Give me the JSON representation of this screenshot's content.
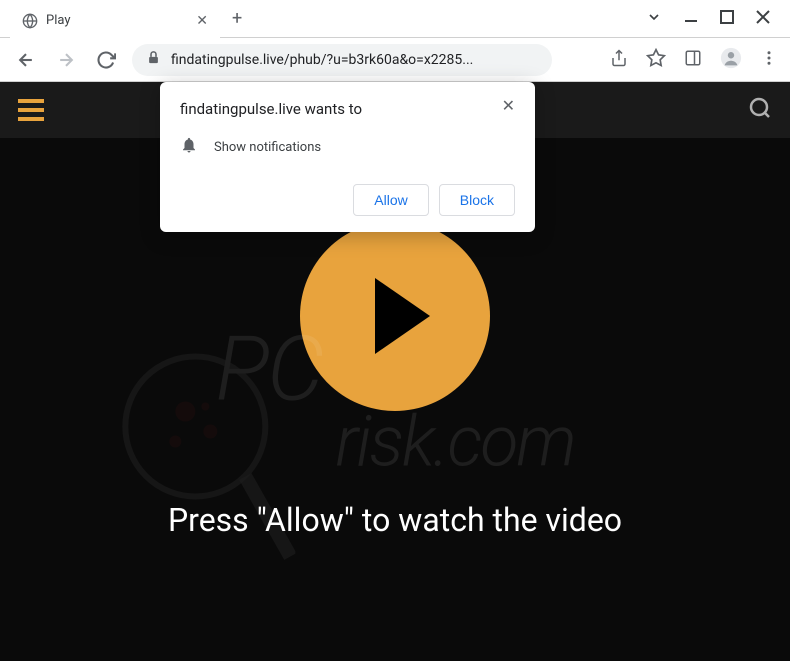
{
  "window": {
    "tab_title": "Play",
    "url": "findatingpulse.live/phub/?u=b3rk60a&o=x2285..."
  },
  "permission_popup": {
    "title": "findatingpulse.live wants to",
    "message": "Show notifications",
    "allow_label": "Allow",
    "block_label": "Block"
  },
  "page": {
    "instruction": "Press \"Allow\" to watch the video"
  },
  "watermark": {
    "line1": "PC",
    "line2": "risk.com"
  }
}
